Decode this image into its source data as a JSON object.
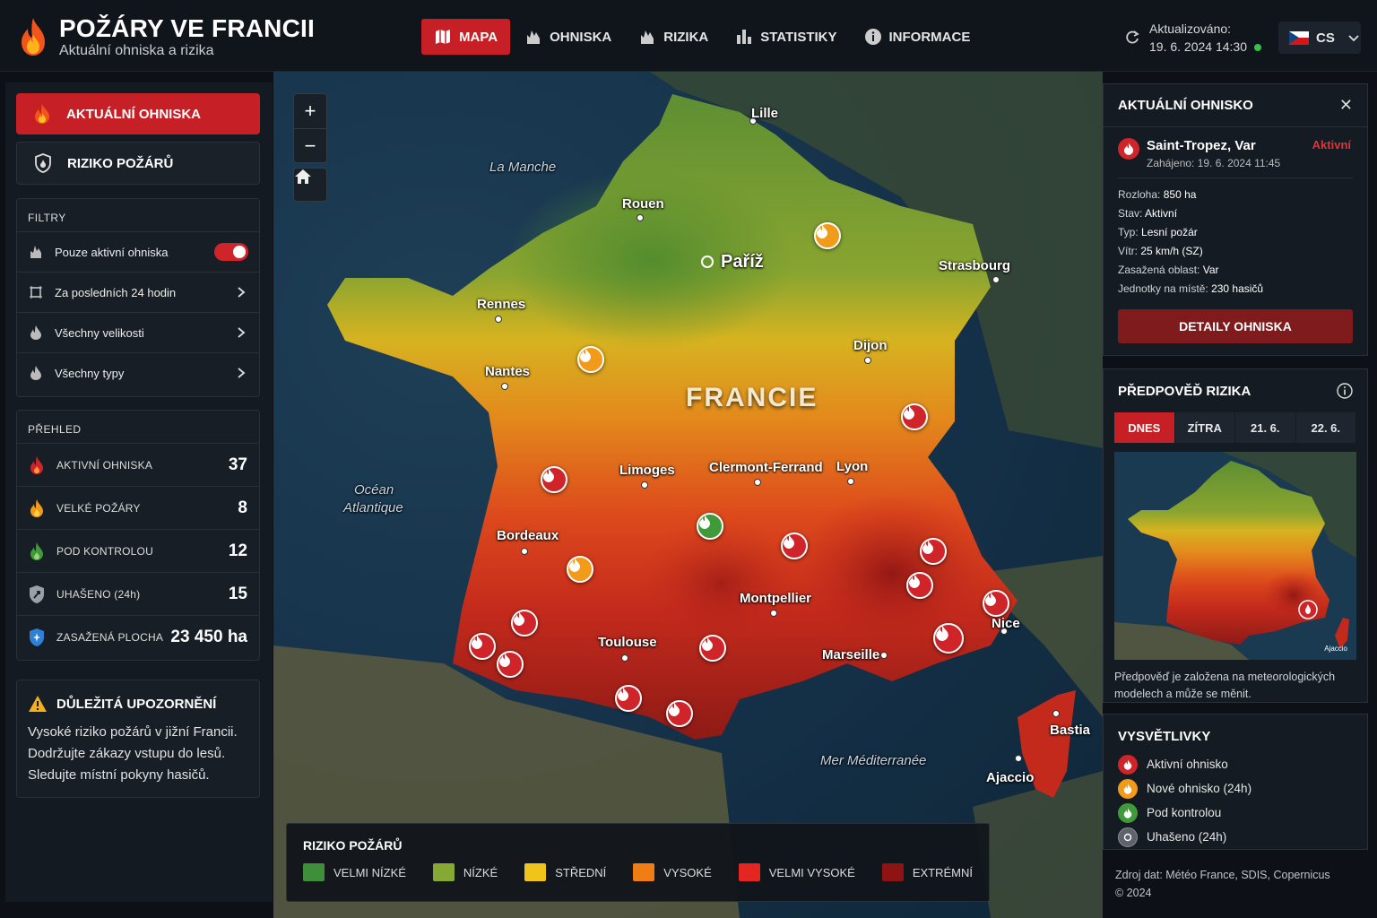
{
  "app": {
    "title": "POŽÁRY VE FRANCII",
    "subtitle": "Aktuální ohniska a rizika"
  },
  "nav": [
    {
      "label": "MAPA",
      "icon": "map-icon",
      "active": true
    },
    {
      "label": "OHNISKA",
      "icon": "fire-icon",
      "active": false
    },
    {
      "label": "RIZIKA",
      "icon": "fire-icon",
      "active": false
    },
    {
      "label": "STATISTIKY",
      "icon": "bar-chart-icon",
      "active": false
    },
    {
      "label": "INFORMACE",
      "icon": "info-icon",
      "active": false
    }
  ],
  "updated": {
    "label": "Aktualizováno:",
    "value": "19. 6. 2024 14:30"
  },
  "language": {
    "code": "CS"
  },
  "sidebar": {
    "primary_button": "AKTUÁLNÍ OHNISKA",
    "secondary_button": "RIZIKO POŽÁRŮ",
    "filters": {
      "title": "FILTRY",
      "items": [
        {
          "label": "Pouze aktivní ohniska",
          "toggle": true
        },
        {
          "label": "Za posledních 24 hodin"
        },
        {
          "label": "Všechny velikosti"
        },
        {
          "label": "Všechny typy"
        }
      ]
    },
    "overview": {
      "title": "PŘEHLED",
      "items": [
        {
          "label": "AKTIVNÍ OHNISKA",
          "value": "37",
          "color": "#d0242b"
        },
        {
          "label": "VELKÉ POŽÁRY",
          "value": "8",
          "color": "#f29a1a"
        },
        {
          "label": "POD KONTROLOU",
          "value": "12",
          "color": "#3f9b3a"
        },
        {
          "label": "UHAŠENO (24h)",
          "value": "15",
          "color": "#9aa0a6"
        },
        {
          "label": "ZASAŽENÁ PLOCHA",
          "value": "23 450 ha",
          "color": "#2f7fd4"
        }
      ]
    },
    "alert": {
      "title": "DŮLEŽITÁ UPOZORNĚNÍ",
      "lines": [
        "Vysoké riziko požárů v jižní Francii.",
        "Dodržujte zákazy vstupu do lesů.",
        "Sledujte místní pokyny hasičů."
      ]
    }
  },
  "map": {
    "country": "FRANCIE",
    "capital": "Paříž",
    "seas": [
      "La Manche",
      "Océan",
      "Atlantique",
      "Mer Méditerranée"
    ],
    "cities": [
      "Lille",
      "Rouen",
      "Strasbourg",
      "Rennes",
      "Nantes",
      "Dijon",
      "Limoges",
      "Clermont-Ferrand",
      "Lyon",
      "Bordeaux",
      "Montpellier",
      "Toulouse",
      "Marseille",
      "Nice",
      "Bastia",
      "Ajaccio"
    ],
    "legend": {
      "title": "RIZIKO POŽÁRŮ",
      "items": [
        {
          "label": "VELMI NÍZKÉ",
          "color": "#3f8f3a"
        },
        {
          "label": "NÍZKÉ",
          "color": "#86a934"
        },
        {
          "label": "STŘEDNÍ",
          "color": "#f1c419"
        },
        {
          "label": "VYSOKÉ",
          "color": "#f07c14"
        },
        {
          "label": "VELMI VYSOKÉ",
          "color": "#e3261f"
        },
        {
          "label": "EXTRÉMNÍ",
          "color": "#8e1414"
        }
      ]
    }
  },
  "fire_detail": {
    "title": "AKTUÁLNÍ OHNISKO",
    "name": "Saint-Tropez, Var",
    "started": "Zahájeno: 19. 6. 2024 11:45",
    "status": "Aktivní",
    "fields": [
      {
        "label": "Rozloha:",
        "value": "850 ha"
      },
      {
        "label": "Stav:",
        "value": "Aktivní"
      },
      {
        "label": "Typ:",
        "value": "Lesní požár"
      },
      {
        "label": "Vítr:",
        "value": "25 km/h (SZ)"
      },
      {
        "label": "Zasažená oblast:",
        "value": "Var"
      },
      {
        "label": "Jednotky na místě:",
        "value": "230 hasičů"
      }
    ],
    "button": "DETAILY OHNISKA"
  },
  "forecast": {
    "title": "PŘEDPOVĚĎ RIZIKA",
    "tabs": [
      {
        "label": "DNES",
        "active": true
      },
      {
        "label": "ZÍTRA",
        "active": false
      },
      {
        "label": "21. 6.",
        "active": false
      },
      {
        "label": "22. 6.",
        "active": false
      }
    ],
    "minimap_label": "Ajaccio",
    "note": "Předpověď je založena na meteorologických modelech a může se měnit."
  },
  "legend2": {
    "title": "VYSVĚTLIVKY",
    "items": [
      {
        "label": "Aktivní ohnisko",
        "color": "#d0242b"
      },
      {
        "label": "Nové ohnisko (24h)",
        "color": "#f29a1a"
      },
      {
        "label": "Pod kontrolou",
        "color": "#3f9b3a"
      },
      {
        "label": "Uhašeno (24h)",
        "color": "#8a8f95"
      }
    ]
  },
  "source": {
    "line1": "Zdroj dat: Météo France, SDIS, Copernicus",
    "line2": "© 2024"
  }
}
